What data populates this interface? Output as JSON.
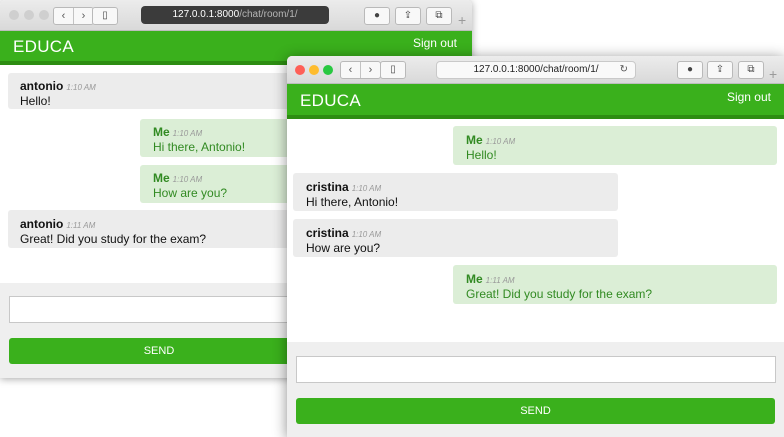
{
  "colors": {
    "brand_green": "#3ab01c",
    "me_bubble": "#dbeed6",
    "other_bubble": "#ececec"
  },
  "back_window": {
    "url_host": "127.0.0.1:8000",
    "url_path": "/chat/room/1/",
    "brand": "EDUCA",
    "signout": "Sign out",
    "messages": [
      {
        "author": "antonio",
        "time": "1:10 AM",
        "text": "Hello!",
        "side": "other"
      },
      {
        "author": "Me",
        "time": "1:10 AM",
        "text": "Hi there, Antonio!",
        "side": "me"
      },
      {
        "author": "Me",
        "time": "1:10 AM",
        "text": "How are you?",
        "side": "me"
      },
      {
        "author": "antonio",
        "time": "1:11 AM",
        "text": "Great! Did you study for the exam?",
        "side": "other"
      }
    ],
    "send_label": "SEND"
  },
  "front_window": {
    "url": "127.0.0.1:8000/chat/room/1/",
    "brand": "EDUCA",
    "signout": "Sign out",
    "messages": [
      {
        "author": "Me",
        "time": "1:10 AM",
        "text": "Hello!",
        "side": "me"
      },
      {
        "author": "cristina",
        "time": "1:10 AM",
        "text": "Hi there, Antonio!",
        "side": "other"
      },
      {
        "author": "cristina",
        "time": "1:10 AM",
        "text": "How are you?",
        "side": "other"
      },
      {
        "author": "Me",
        "time": "1:11 AM",
        "text": "Great! Did you study for the exam?",
        "side": "me"
      }
    ],
    "send_label": "SEND"
  },
  "icons": {
    "back": "back-arrow-icon",
    "forward": "forward-arrow-icon",
    "sidebar": "sidebar-icon",
    "reload": "reload-icon",
    "download": "download-icon",
    "share": "share-icon",
    "tabs": "tabs-icon",
    "new_tab": "plus-icon"
  }
}
